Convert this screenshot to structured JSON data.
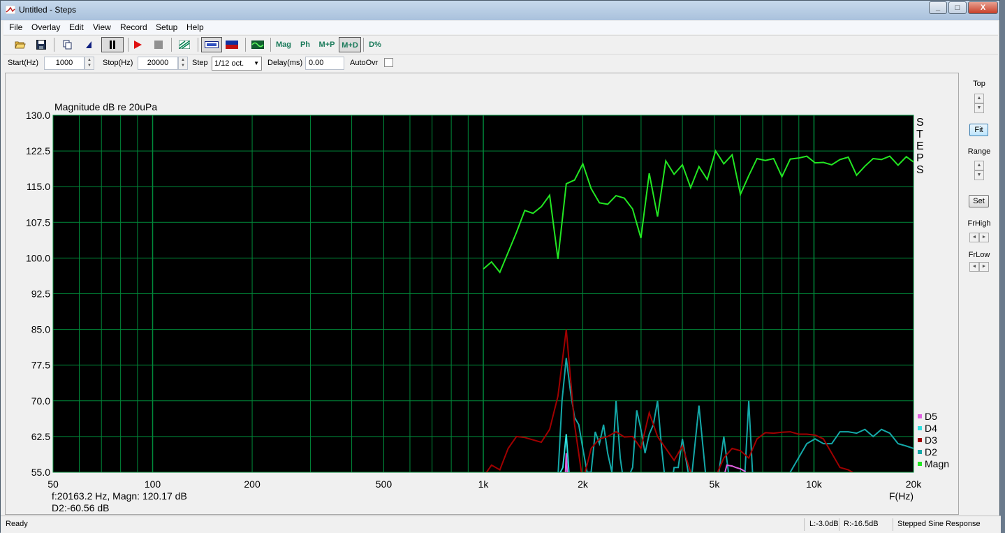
{
  "window": {
    "title": "Untitled - Steps",
    "min": "_",
    "max": "□",
    "close": "X"
  },
  "menu": [
    "File",
    "Overlay",
    "Edit",
    "View",
    "Record",
    "Setup",
    "Help"
  ],
  "toolbar": {
    "mag": "Mag",
    "ph": "Ph",
    "mp": "M+P",
    "md": "M+D",
    "dpct": "D%"
  },
  "params": {
    "start_label": "Start(Hz)",
    "start_value": "1000",
    "stop_label": "Stop(Hz)",
    "stop_value": "20000",
    "step_label": "Step",
    "step_value": "1/12 oct.",
    "delay_label": "Delay(ms)",
    "delay_value": "0.00",
    "autoovr_label": "AutoOvr"
  },
  "side": {
    "top_label": "Top",
    "fit": "Fit",
    "range_label": "Range",
    "set": "Set",
    "frhigh_label": "FrHigh",
    "frlow_label": "FrLow"
  },
  "readout": {
    "line1": "f:20163.2 Hz, Magn: 120.17 dB",
    "line2": "D2:-60.56 dB"
  },
  "status": {
    "ready": "Ready",
    "left": "L:-3.0dB",
    "right": "R:-16.5dB",
    "mode": "Stepped Sine Response"
  },
  "colors": {
    "bg": "#000000",
    "grid": "#008a3a",
    "magn": "#22e622",
    "d2": "#14a8a8",
    "d3": "#a00000",
    "d4": "#30e0e0",
    "d5": "#e060e0"
  },
  "chart_data": {
    "type": "line",
    "title": "Magnitude dB re 20uPa",
    "xlabel": "F(Hz)",
    "xscale": "log",
    "xlim": [
      50,
      20000
    ],
    "ylim": [
      55,
      130
    ],
    "yticks": [
      "130.0",
      "122.5",
      "115.0",
      "107.5",
      "100.0",
      "92.5",
      "85.0",
      "77.5",
      "70.0",
      "62.5",
      "55.0"
    ],
    "xticks": [
      {
        "v": 50,
        "l": "50"
      },
      {
        "v": 100,
        "l": "100"
      },
      {
        "v": 200,
        "l": "200"
      },
      {
        "v": 500,
        "l": "500"
      },
      {
        "v": 1000,
        "l": "1k"
      },
      {
        "v": 2000,
        "l": "2k"
      },
      {
        "v": 5000,
        "l": "5k"
      },
      {
        "v": 10000,
        "l": "10k"
      },
      {
        "v": 20000,
        "l": "20k"
      }
    ],
    "side_label": [
      "S",
      "T",
      "E",
      "P",
      "S"
    ],
    "legend": [
      "D5",
      "D4",
      "D3",
      "D2",
      "Magn"
    ],
    "series": [
      {
        "name": "Magn",
        "color": "#22e622",
        "x": [
          1000,
          1059,
          1122,
          1189,
          1260,
          1335,
          1414,
          1498,
          1587,
          1682,
          1782,
          1888,
          2000,
          2119,
          2245,
          2378,
          2520,
          2670,
          2828,
          2997,
          3175,
          3364,
          3564,
          3775,
          4000,
          4238,
          4490,
          4757,
          5040,
          5339,
          5657,
          5993,
          6350,
          6727,
          7127,
          7551,
          8000,
          8476,
          8980,
          9514,
          10079,
          10679,
          11314,
          11986,
          12699,
          13454,
          14254,
          15102,
          16000,
          16951,
          17959,
          19027,
          20000
        ],
        "y": [
          97.7,
          99.2,
          97.0,
          101.2,
          105.4,
          110.0,
          109.4,
          110.8,
          113.2,
          99.8,
          115.6,
          116.4,
          119.8,
          114.6,
          111.6,
          111.3,
          113.1,
          112.6,
          110.3,
          104.2,
          117.8,
          108.7,
          120.4,
          117.6,
          119.6,
          114.8,
          119.2,
          116.5,
          122.5,
          119.8,
          121.7,
          113.4,
          117.3,
          120.9,
          120.5,
          120.9,
          117.1,
          120.8,
          121.0,
          121.4,
          120.0,
          120.1,
          119.6,
          120.7,
          121.2,
          117.4,
          119.3,
          120.9,
          120.7,
          121.4,
          119.5,
          121.3,
          120.2
        ]
      },
      {
        "name": "D2",
        "color": "#14a8a8",
        "x": [
          1682,
          1730,
          1782,
          1835,
          1888,
          1944,
          2000,
          2060,
          2119,
          2181,
          2245,
          2311,
          2378,
          2448,
          2520,
          2595,
          2670,
          2748,
          2828,
          2911,
          2997,
          3085,
          3175,
          3268,
          3364,
          3463,
          3564,
          3669,
          3775,
          3886,
          4000,
          4238,
          4490,
          4757,
          5040,
          5339,
          5657,
          5993,
          6173,
          6350,
          6540,
          6727,
          6930,
          7127,
          7551,
          8000,
          8476,
          8980,
          9514,
          10079,
          10679,
          11314,
          11986,
          12699,
          13454,
          14254,
          15102,
          16000,
          16951,
          17959,
          19027,
          20000
        ],
        "y": [
          54,
          70,
          79,
          72,
          66.5,
          65,
          60,
          55,
          55,
          63.5,
          61,
          65,
          59,
          55,
          70,
          58,
          52,
          54,
          56,
          68,
          64,
          59,
          63,
          65,
          70,
          60,
          52,
          50,
          56,
          56,
          62,
          52,
          69,
          51,
          50,
          62.5,
          49,
          55,
          54,
          70,
          53,
          48,
          50,
          51,
          50,
          52,
          55,
          58,
          61,
          62,
          61,
          61,
          63.5,
          63.5,
          63.2,
          64,
          62.5,
          64,
          63.2,
          61,
          60.5,
          60
        ]
      },
      {
        "name": "D3",
        "color": "#a00000",
        "x": [
          1000,
          1059,
          1122,
          1189,
          1260,
          1335,
          1414,
          1498,
          1587,
          1682,
          1782,
          1888,
          2000,
          2119,
          2245,
          2378,
          2520,
          2670,
          2828,
          2997,
          3175,
          3364,
          3564,
          3775,
          4000,
          4238,
          4490,
          4757,
          5040,
          5339,
          5657,
          5993,
          6350,
          6727,
          7127,
          7551,
          8000,
          8476,
          8980,
          9514,
          10079,
          10679,
          11314,
          11986,
          12699,
          13454,
          14254,
          15102,
          16000
        ],
        "y": [
          54,
          56.5,
          55.5,
          60,
          62.5,
          62.3,
          61.8,
          61.3,
          64,
          71,
          85,
          65,
          53,
          60,
          62,
          62.5,
          63.5,
          62.4,
          62.5,
          60,
          67.5,
          62.5,
          60,
          57.5,
          60.5,
          55,
          53,
          51,
          54,
          58,
          60,
          59.5,
          58,
          62,
          63.3,
          63.2,
          63.4,
          63.5,
          63,
          63,
          62.8,
          62,
          59,
          56,
          55.5,
          54.5,
          53,
          52,
          51
        ]
      },
      {
        "name": "D4",
        "color": "#30e0e0",
        "x": [
          1682,
          1740,
          1782,
          1820,
          1860
        ],
        "y": [
          54,
          56,
          63,
          54,
          50
        ]
      },
      {
        "name": "D5",
        "color": "#e060e0",
        "x": [
          1740,
          1770,
          1782,
          1800,
          1840,
          5339,
          5450,
          5550,
          5657,
          5800,
          5993,
          6173,
          6350
        ],
        "y": [
          52,
          54,
          59,
          53,
          50,
          54,
          56.5,
          56.4,
          56.3,
          56,
          55.7,
          55.2,
          54
        ]
      }
    ]
  }
}
